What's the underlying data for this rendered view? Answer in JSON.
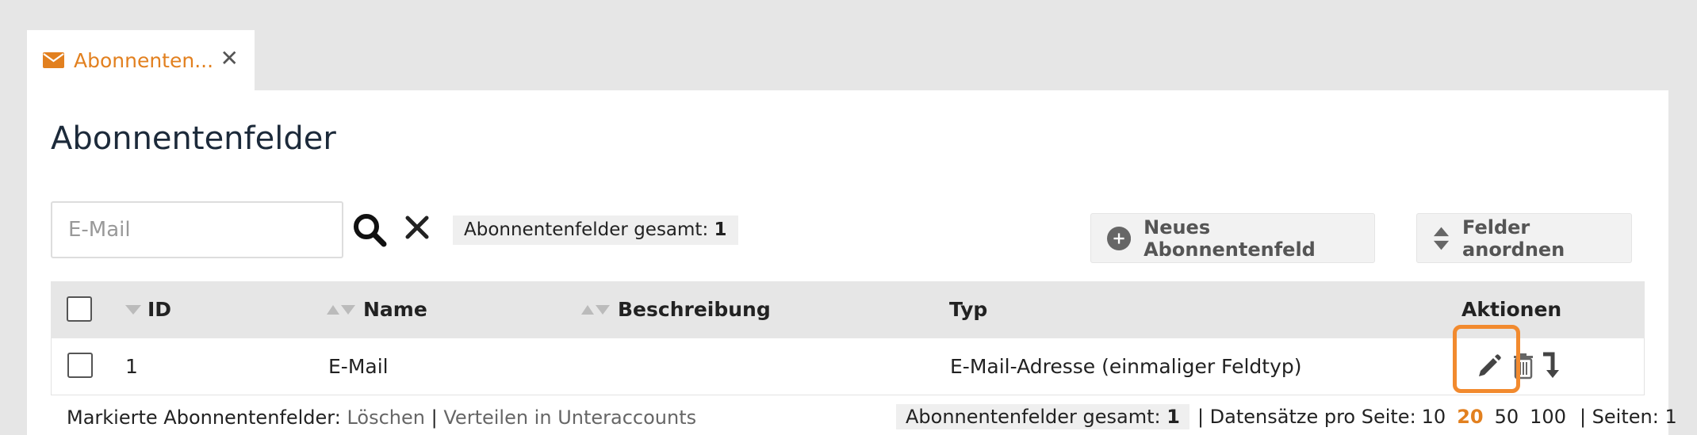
{
  "tab": {
    "label": "Abonnenten...",
    "icon": "envelope-icon"
  },
  "page": {
    "title": "Abonnentenfelder"
  },
  "search": {
    "placeholder": "E-Mail"
  },
  "total": {
    "label": "Abonnentenfelder gesamt:",
    "count": "1"
  },
  "buttons": {
    "new_field": "Neues Abonnentenfeld",
    "order_fields": "Felder anordnen"
  },
  "table": {
    "headers": {
      "id": "ID",
      "name": "Name",
      "description": "Beschreibung",
      "type": "Typ",
      "actions": "Aktionen"
    },
    "rows": [
      {
        "id": "1",
        "name": "E-Mail",
        "description": "",
        "type": "E-Mail-Adresse (einmaliger Feldtyp)"
      }
    ]
  },
  "footer": {
    "marked_label": "Markierte Abonnentenfelder:",
    "delete_link": "Löschen",
    "separator": "|",
    "distribute_link": "Verteilen in Unteraccounts",
    "total_label": "Abonnentenfelder gesamt:",
    "total_count": "1",
    "per_page_label": "| Datensätze pro Seite:",
    "per_page_options": [
      "10",
      "20",
      "50",
      "100"
    ],
    "per_page_selected": "20",
    "pages_label": "| Seiten: 1"
  },
  "colors": {
    "accent": "#e2801f",
    "highlight": "#f28a2e"
  }
}
